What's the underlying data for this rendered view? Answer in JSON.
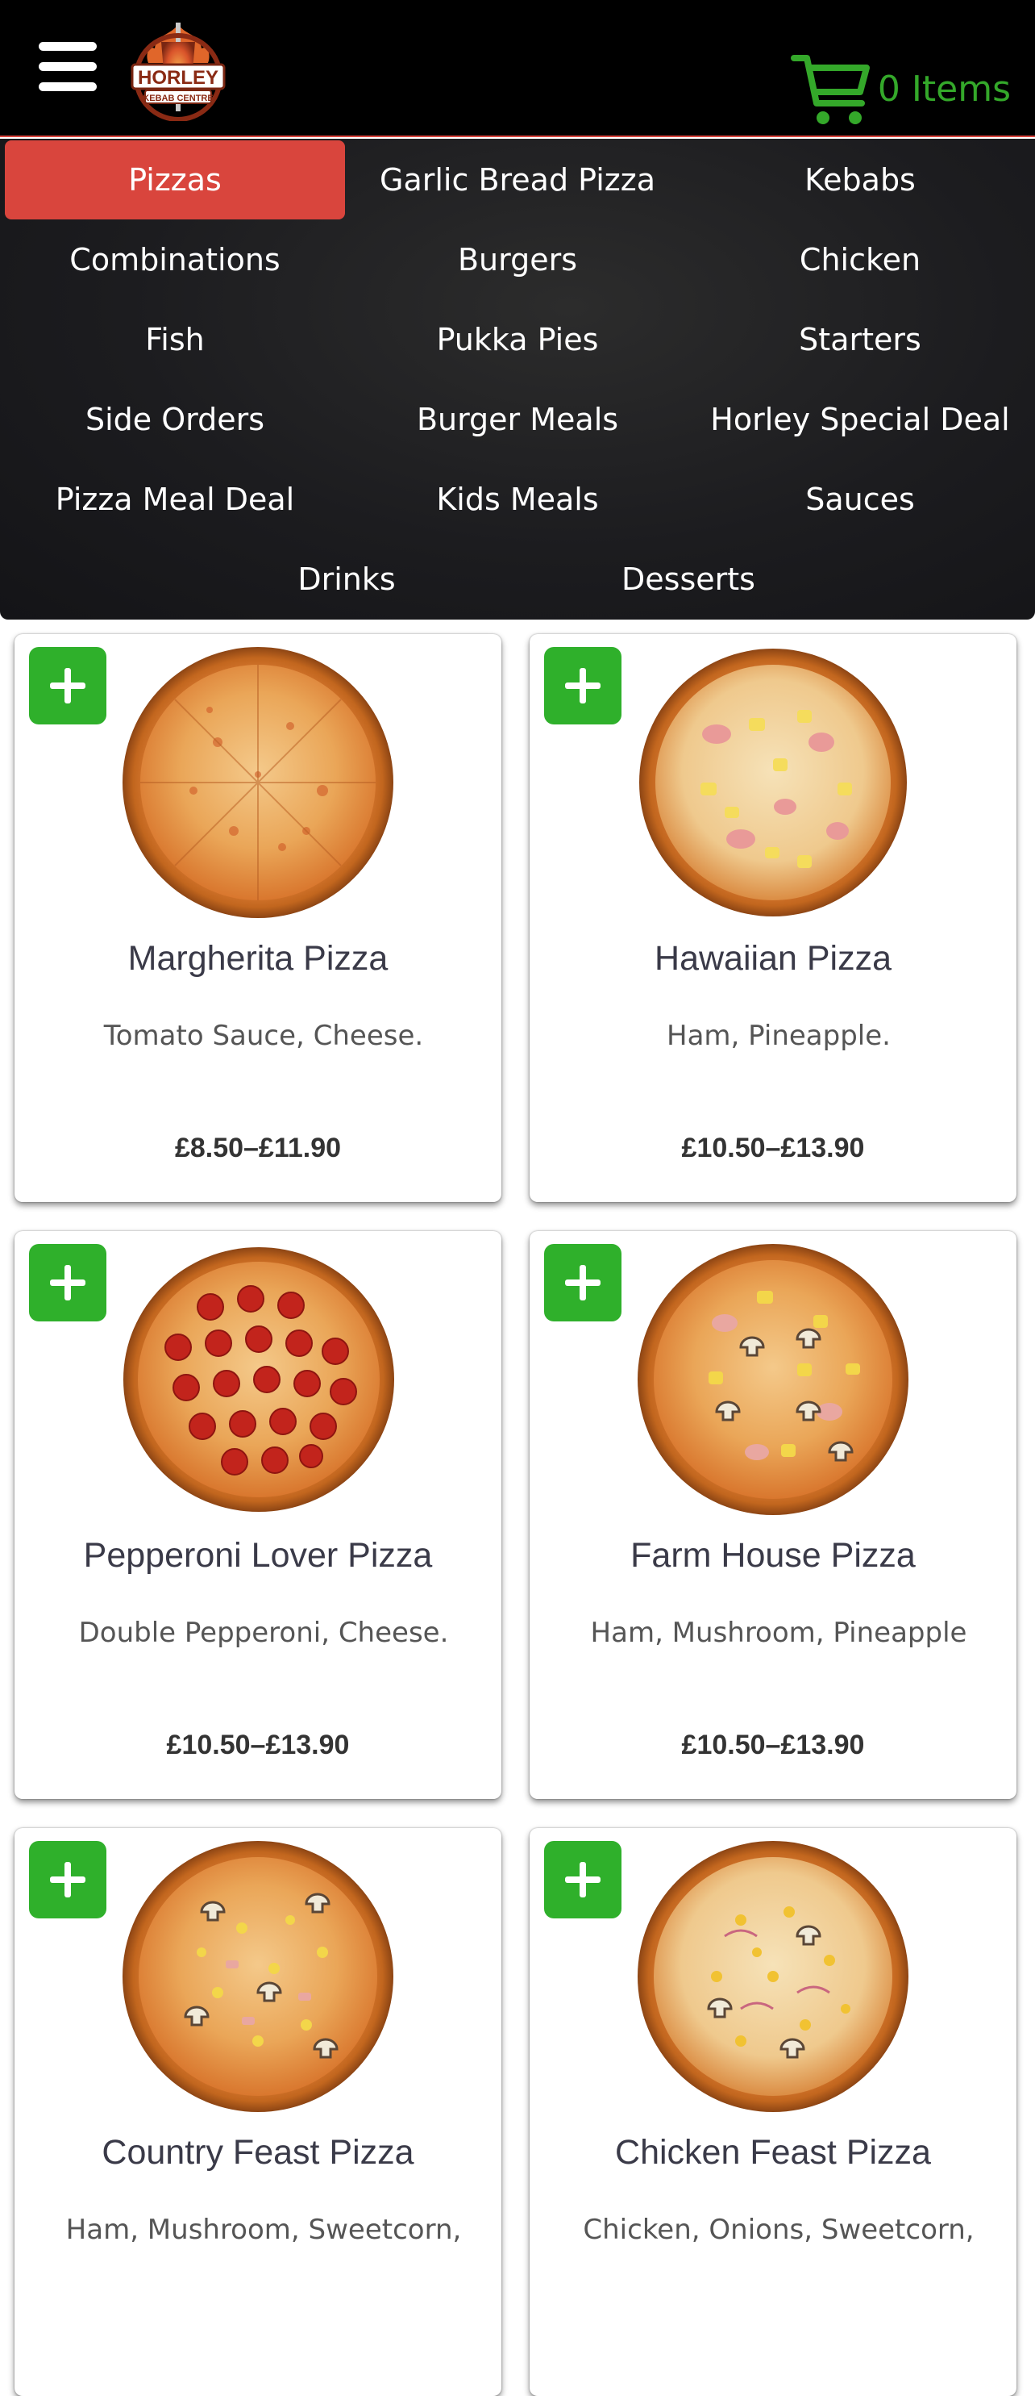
{
  "header": {
    "menu_icon": "hamburger-menu-icon",
    "logo": {
      "line1": "HORLEY",
      "line2": "KEBAB CENTRE"
    },
    "cart": {
      "icon": "cart-icon",
      "label": "0 Items"
    }
  },
  "categories": [
    {
      "label": "Pizzas",
      "active": true
    },
    {
      "label": "Garlic Bread Pizza"
    },
    {
      "label": "Kebabs"
    },
    {
      "label": "Combinations"
    },
    {
      "label": "Burgers"
    },
    {
      "label": "Chicken"
    },
    {
      "label": "Fish"
    },
    {
      "label": "Pukka Pies"
    },
    {
      "label": "Starters"
    },
    {
      "label": "Side Orders"
    },
    {
      "label": "Burger Meals"
    },
    {
      "label": "Horley Special Deal"
    },
    {
      "label": "Pizza Meal Deal"
    },
    {
      "label": "Kids Meals"
    },
    {
      "label": "Sauces"
    },
    {
      "label": "Drinks"
    },
    {
      "label": "Desserts"
    }
  ],
  "products": [
    {
      "name": "Margherita Pizza",
      "description": "Tomato Sauce, Cheese.",
      "price": "£8.50–£11.90",
      "image": "margherita-pizza-image"
    },
    {
      "name": "Hawaiian Pizza",
      "description": "Ham, Pineapple.",
      "price": "£10.50–£13.90",
      "image": "hawaiian-pizza-image"
    },
    {
      "name": "Pepperoni Lover Pizza",
      "description": "Double Pepperoni, Cheese.",
      "price": "£10.50–£13.90",
      "image": "pepperoni-pizza-image"
    },
    {
      "name": "Farm House Pizza",
      "description": "Ham, Mushroom, Pineapple",
      "price": "£10.50–£13.90",
      "image": "farm-house-pizza-image"
    },
    {
      "name": "Country Feast Pizza",
      "description": "Ham, Mushroom, Sweetcorn,",
      "price": "",
      "image": "country-feast-pizza-image"
    },
    {
      "name": "Chicken Feast Pizza",
      "description": "Chicken, Onions, Sweetcorn,",
      "price": "",
      "image": "chicken-feast-pizza-image"
    }
  ],
  "colors": {
    "accent_red": "#d9453d",
    "add_green": "#2fb02b",
    "cart_green": "#34a82a",
    "header_bg": "#000000",
    "nav_bg": "#1c1c1f"
  }
}
